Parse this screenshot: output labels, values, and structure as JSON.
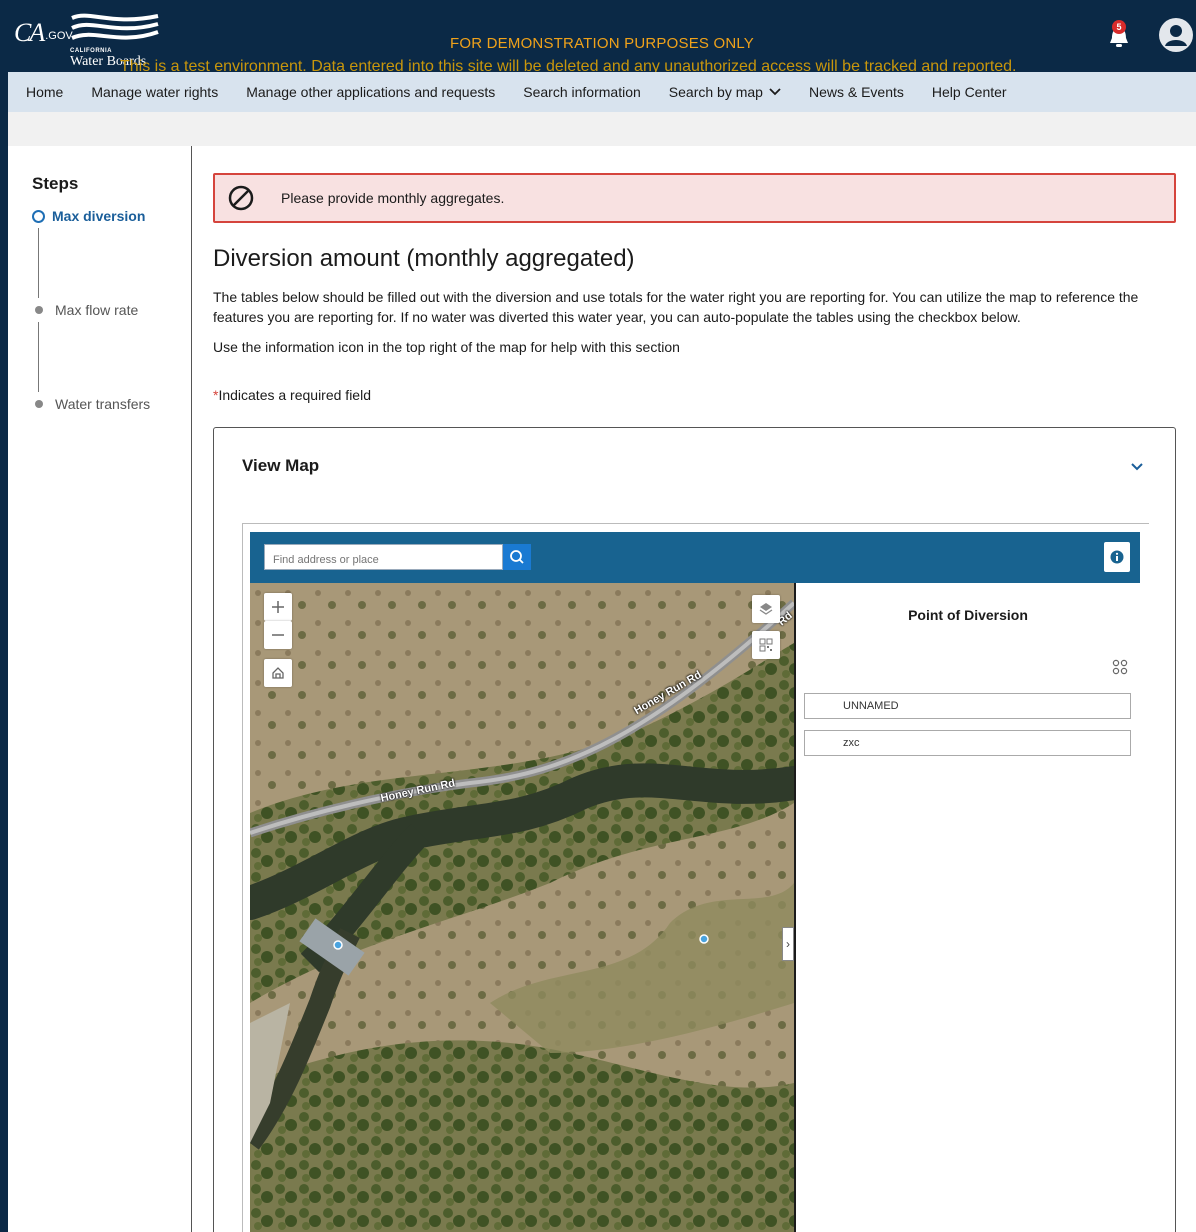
{
  "header": {
    "ca_logo": "CA",
    "ca_logo_suffix": ".GOV",
    "org_small": "CALIFORNIA",
    "org_name": "Water Boards",
    "demo_banner": "FOR DEMONSTRATION PURPOSES ONLY",
    "test_banner": "This is a test environment. Data entered into this site will be deleted and any unauthorized access will be tracked and reported.",
    "notification_count": "5",
    "icons": {
      "bell": "bell-icon",
      "avatar": "user-avatar-icon"
    }
  },
  "nav": {
    "items": [
      "Home",
      "Manage water rights",
      "Manage other applications and requests",
      "Search information",
      "Search by map",
      "News & Events",
      "Help Center"
    ]
  },
  "steps": {
    "title": "Steps",
    "items": [
      {
        "label": "Max diversion",
        "state": "active"
      },
      {
        "label": "Max flow rate",
        "state": "pending"
      },
      {
        "label": "Water transfers",
        "state": "pending"
      }
    ]
  },
  "alert": {
    "text": "Please provide monthly aggregates.",
    "icon": "prohibited-icon",
    "color": "#d5443c"
  },
  "content": {
    "title": "Diversion amount (monthly aggregated)",
    "description": "The tables below should be filled out with the diversion and use totals for the water right you are reporting for. You can utilize the map to reference the features you are reporting for. If no water was diverted this water year, you can auto-populate the tables using the checkbox below.",
    "info_note": "Use the information icon in the top right of the map for help with this section",
    "required_star": "*",
    "required_note": "Indicates a required field"
  },
  "map_panel": {
    "title": "View Map",
    "search_placeholder": "Find address or place",
    "side_title": "Point of Diversion",
    "side_fields": [
      "UNNAMED",
      "zxc"
    ],
    "road_labels": [
      "Honey Run Rd",
      "Honey Run Rd",
      "Rd"
    ],
    "accent_color": "#186390"
  }
}
